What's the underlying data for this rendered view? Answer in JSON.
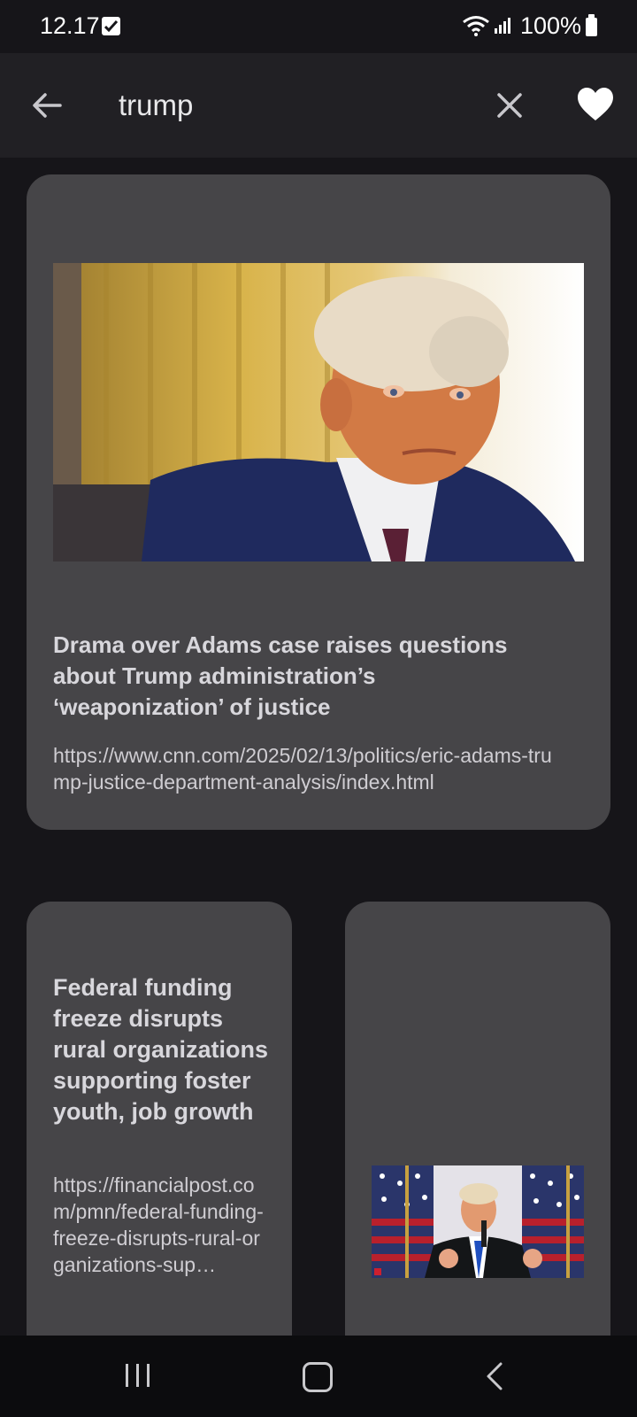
{
  "status_bar": {
    "time": "12.17",
    "battery": "100%"
  },
  "search": {
    "query": "trump"
  },
  "articles": [
    {
      "title": "Drama over Adams case raises questions about Trump administration’s ‘weaponization’ of justice",
      "url": "https://www.cnn.com/2025/02/13/politics/eric-adams-trump-justice-department-analysis/index.html"
    },
    {
      "title": "Federal funding freeze disrupts rural organizations supporting foster youth, job growth",
      "url": "https://financialpost.com/pmn/federal-funding-freeze-disrupts-rural-organizations-sup…"
    },
    {
      "title": "",
      "url": ""
    }
  ],
  "icons": {
    "back": "arrow-left-icon",
    "clear": "close-icon",
    "favorite": "heart-icon",
    "nav_recent": "recent-apps-icon",
    "nav_home": "home-icon",
    "nav_back": "chevron-left-icon"
  },
  "colors": {
    "background": "#161519",
    "appbar": "#212024",
    "card": "#464548",
    "title_text": "#d8d7dc"
  }
}
